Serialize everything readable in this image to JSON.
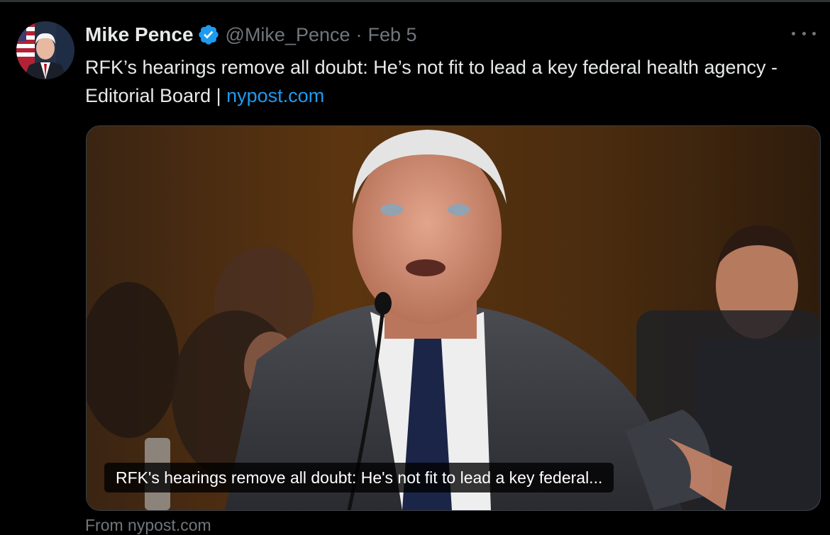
{
  "tweet": {
    "display_name": "Mike Pence",
    "handle": "@Mike_Pence",
    "separator": "·",
    "date": "Feb 5",
    "text": "RFK’s hearings remove all doubt: He’s not fit to lead a key federal health agency - Editorial Board | ",
    "link_text": "nypost.com",
    "verified": true,
    "avatar_icon": "avatar-photo",
    "more_icon": "more-options-icon"
  },
  "card": {
    "caption": "RFK's hearings remove all doubt: He's not fit to lead a key federal...",
    "source": "From nypost.com"
  },
  "colors": {
    "background": "#000000",
    "text_primary": "#e7e9ea",
    "text_secondary": "#71767b",
    "link": "#1d9bf0",
    "verified_badge": "#1d9bf0",
    "border": "#2f3336"
  }
}
